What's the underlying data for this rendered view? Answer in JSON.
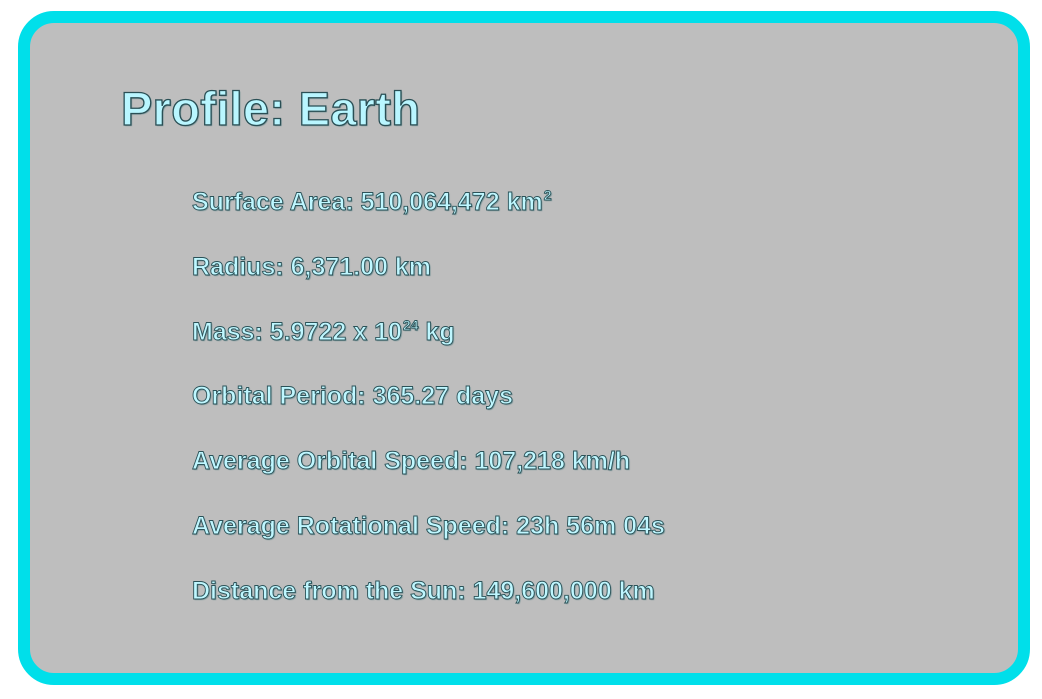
{
  "profile": {
    "title": "Profile: Earth",
    "stats": [
      {
        "text": "Surface Area: 510,064,472 km",
        "sup": "2"
      },
      {
        "text": "Radius: 6,371.00 km",
        "sup": ""
      },
      {
        "text": "Mass: 5.9722 x 10",
        "sup": "24",
        "after": " kg"
      },
      {
        "text": "Orbital Period: 365.27 days",
        "sup": ""
      },
      {
        "text": "Average Orbital Speed: 107,218 km/h",
        "sup": ""
      },
      {
        "text": "Average Rotational Speed: 23h 56m 04s",
        "sup": ""
      },
      {
        "text": "Distance from the Sun: 149,600,000 km",
        "sup": ""
      }
    ]
  },
  "colors": {
    "border": "#00dfea",
    "panel": "#bebebe",
    "text": "#bff7ff"
  }
}
